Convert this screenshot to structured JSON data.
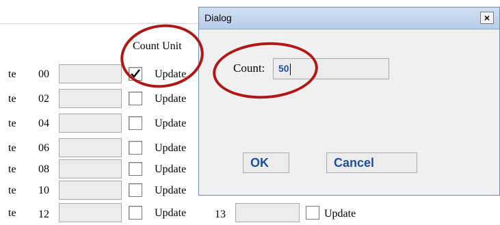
{
  "background_form": {
    "column_header": "Count Unit",
    "rows": [
      {
        "cut": "te",
        "num": "00",
        "label": "Update",
        "checked": true
      },
      {
        "cut": "te",
        "num": "02",
        "label": "Update",
        "checked": false
      },
      {
        "cut": "te",
        "num": "04",
        "label": "Update",
        "checked": false
      },
      {
        "cut": "te",
        "num": "06",
        "label": "Update",
        "checked": false
      },
      {
        "cut": "te",
        "num": "08",
        "label": "Update",
        "checked": false
      },
      {
        "cut": "te",
        "num": "10",
        "label": "Update",
        "checked": false
      },
      {
        "cut": "te",
        "num": "12",
        "label": "Update",
        "checked": false
      }
    ],
    "extra_row": {
      "num": "13",
      "label": "Update",
      "checked": false
    }
  },
  "dialog": {
    "title": "Dialog",
    "close_symbol": "×",
    "count_label": "Count:",
    "count_value": "50",
    "ok_label": "OK",
    "cancel_label": "Cancel"
  },
  "colors": {
    "annotation_ring": "#b01818",
    "button_text": "#1d4f9c"
  }
}
